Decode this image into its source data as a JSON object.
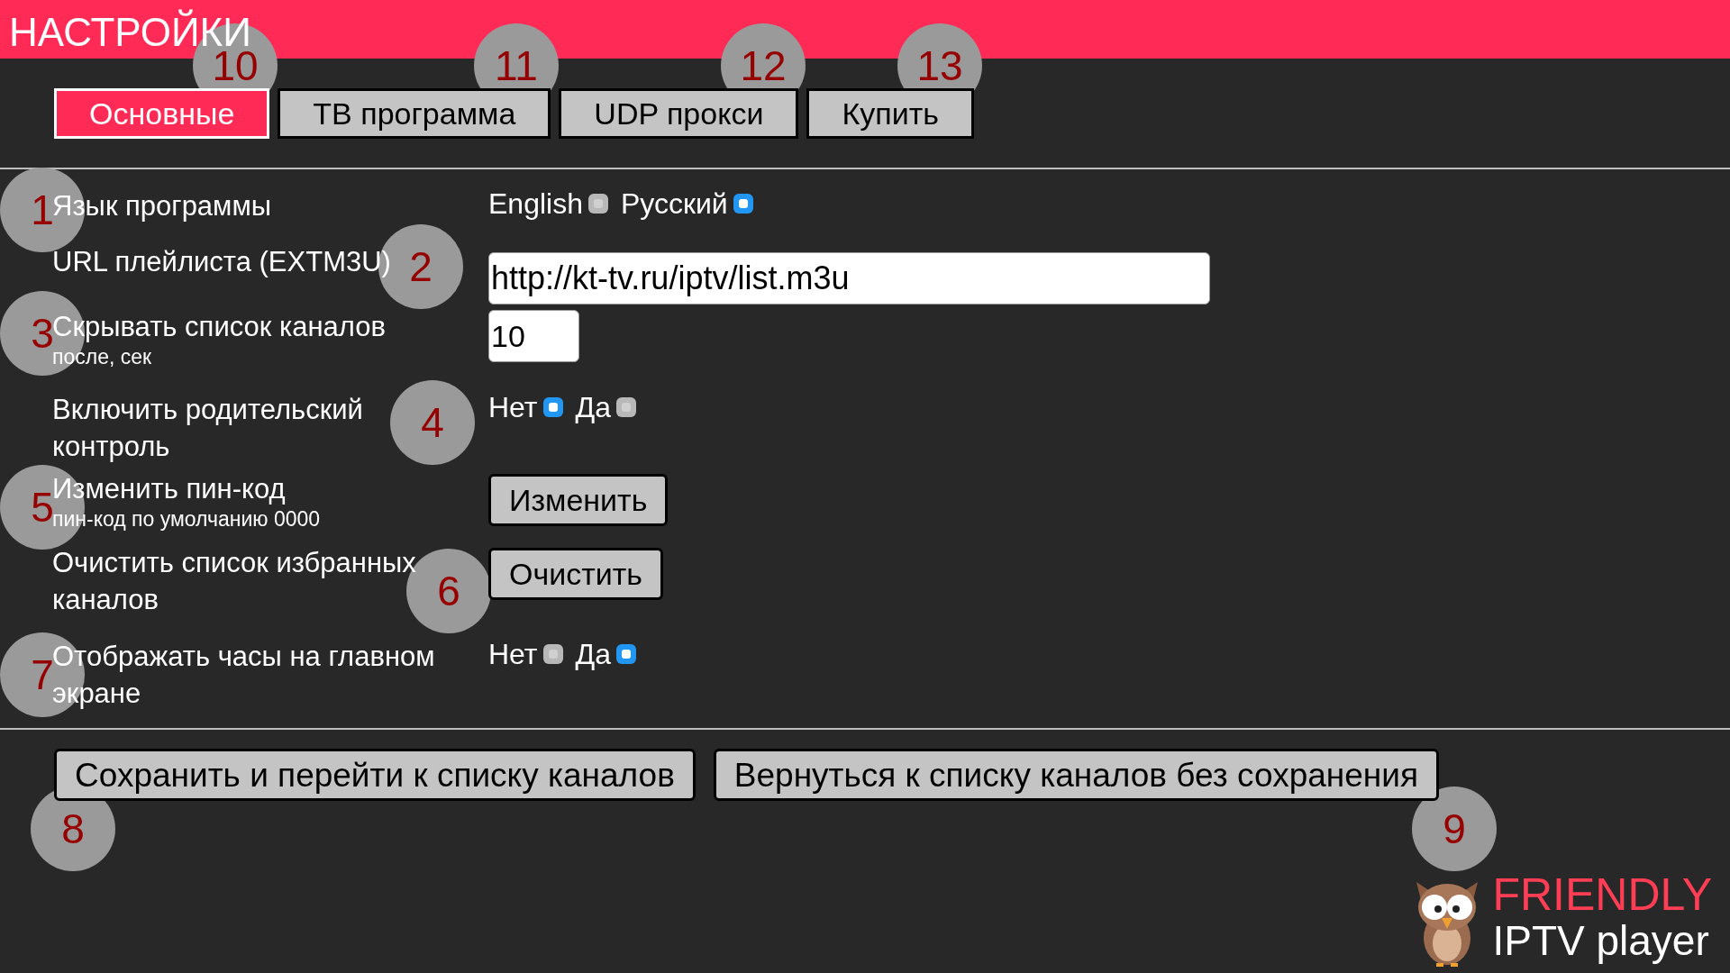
{
  "header": {
    "title": "НАСТРОЙКИ"
  },
  "tabs": [
    {
      "label": "Основные",
      "selected": true
    },
    {
      "label": "ТВ программа",
      "selected": false
    },
    {
      "label": "UDP прокси",
      "selected": false
    },
    {
      "label": "Купить",
      "selected": false
    }
  ],
  "settings": [
    {
      "kind": "radio",
      "label": "Язык программы",
      "options": [
        {
          "label": "English",
          "selected": false
        },
        {
          "label": "Русский",
          "selected": true
        }
      ]
    },
    {
      "kind": "text",
      "label": "URL плейлиста (EXTM3U)",
      "value": "http://kt-tv.ru/iptv/list.m3u"
    },
    {
      "kind": "number",
      "label": "Скрывать список каналов",
      "hint": "после, сек",
      "value": "10"
    },
    {
      "kind": "radio",
      "label": "Включить родительский контроль",
      "options": [
        {
          "label": "Нет",
          "selected": true
        },
        {
          "label": "Да",
          "selected": false
        }
      ]
    },
    {
      "kind": "button",
      "label": "Изменить пин-код",
      "hint": "пин-код по умолчанию 0000",
      "button": "Изменить"
    },
    {
      "kind": "button",
      "label": "Очистить список избранных каналов",
      "button": "Очистить"
    },
    {
      "kind": "radio",
      "label": "Отображать часы на главном экране",
      "options": [
        {
          "label": "Нет",
          "selected": false
        },
        {
          "label": "Да",
          "selected": true
        }
      ]
    }
  ],
  "actions": [
    "Сохранить и перейти к списку каналов",
    "Вернуться к списку каналов без сохранения"
  ],
  "logo": {
    "line_1": "FRIENDLY",
    "line_2": "IPTV player"
  },
  "annotations": [
    {
      "label": "10"
    },
    {
      "label": "11"
    },
    {
      "label": "12"
    },
    {
      "label": "13"
    },
    {
      "label": "1"
    },
    {
      "label": "2"
    },
    {
      "label": "3"
    },
    {
      "label": "4"
    },
    {
      "label": "5"
    },
    {
      "label": "6"
    },
    {
      "label": "7"
    },
    {
      "label": "8"
    },
    {
      "label": "9"
    }
  ]
}
